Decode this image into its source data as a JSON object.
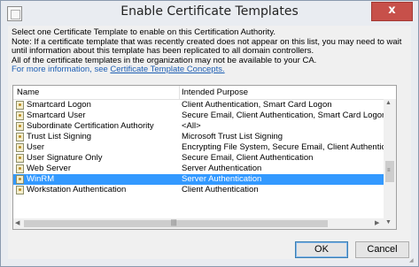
{
  "window": {
    "title": "Enable Certificate Templates",
    "close_glyph": "x"
  },
  "intro": {
    "line1": "Select one Certificate Template to enable on this Certification Authority.",
    "line2": "Note: If a certificate template that was recently created does not appear on this list, you may need to wait until information about this template has been replicated to all domain controllers.",
    "line3": "All of the certificate templates in the organization may not be available to your CA.",
    "more_prefix": "For more information, see ",
    "more_link": "Certificate Template Concepts."
  },
  "table": {
    "columns": [
      "Name",
      "Intended Purpose"
    ],
    "rows": [
      {
        "name": "Smartcard Logon",
        "purpose": "Client Authentication, Smart Card Logon",
        "selected": false
      },
      {
        "name": "Smartcard User",
        "purpose": "Secure Email, Client Authentication, Smart Card Logon",
        "selected": false
      },
      {
        "name": "Subordinate Certification Authority",
        "purpose": "<All>",
        "selected": false
      },
      {
        "name": "Trust List Signing",
        "purpose": "Microsoft Trust List Signing",
        "selected": false
      },
      {
        "name": "User",
        "purpose": "Encrypting File System, Secure Email, Client Authentication",
        "selected": false
      },
      {
        "name": "User Signature Only",
        "purpose": "Secure Email, Client Authentication",
        "selected": false
      },
      {
        "name": "Web Server",
        "purpose": "Server Authentication",
        "selected": false
      },
      {
        "name": "WinRM",
        "purpose": "Server Authentication",
        "selected": true
      },
      {
        "name": "Workstation Authentication",
        "purpose": "Client Authentication",
        "selected": false
      }
    ]
  },
  "buttons": {
    "ok": "OK",
    "cancel": "Cancel"
  },
  "icons": {
    "row_icon": "certificate-template-icon",
    "app_icon": "window-icon"
  },
  "colors": {
    "selection": "#3399ff",
    "link": "#1e5fb4",
    "close_button": "#c7504a"
  }
}
